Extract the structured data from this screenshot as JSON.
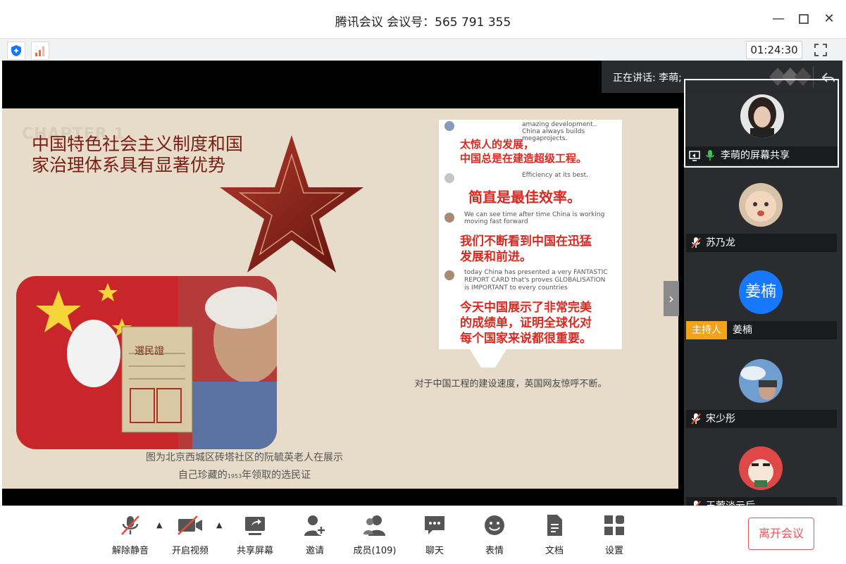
{
  "window": {
    "title": "腾讯会议 会议号：565 791 355"
  },
  "toolstrip": {
    "timer": "01:24:30"
  },
  "speaking": {
    "label": "正在讲话: 李萌;"
  },
  "slide": {
    "chapter": "CHAPTER 1",
    "heading_line1": "中国特色社会主义制度和国",
    "heading_line2": "家治理体系具有显著优势",
    "photo_caption_line1": "图为北京西城区砖塔社区的阮毓英老人在展示",
    "photo_caption_line2_a": "自己珍藏的",
    "photo_caption_line2_year": "1953",
    "photo_caption_line2_b": "年领取的选民证",
    "voter_card_title": "選民證",
    "comments": [
      {
        "en": "amazing development.. China always builds megaprojects.",
        "zh1": "太惊人的发展，",
        "zh2": "中国总是在建造超级工程。"
      },
      {
        "en": "Efficiency at its best.",
        "zh1": "简直是最佳效率。",
        "zh2": ""
      },
      {
        "en": "We can see time after time China is working moving fast forward",
        "zh1": "我们不断看到中国在迅猛",
        "zh2": "发展和前进。"
      },
      {
        "en": "today China has presented a very FANTASTIC REPORT CARD that's proves GLOBALISATION is IMPORTANT to every countries",
        "zh1": "今天中国展示了非常完美",
        "zh2": "的成绩单，证明全球化对",
        "zh3": "每个国家来说都很重要。"
      }
    ],
    "shot_caption": "对于中国工程的建设速度，英国网友惊呼不断。"
  },
  "participants": [
    {
      "name": "李萌的屏幕共享",
      "mic": "on",
      "avatar_color": "#3a3a3a"
    },
    {
      "name": "苏乃龙",
      "mic": "muted",
      "avatar_color": "#d8c3a8"
    },
    {
      "name": "姜楠",
      "mic": "none",
      "host": "主持人",
      "avatar_text": "姜楠",
      "avatar_color": "#1677ff"
    },
    {
      "name": "宋少彤",
      "mic": "muted",
      "avatar_color": "#7ea9d4"
    },
    {
      "name": "王莺淡云后",
      "mic": "muted",
      "avatar_color": "#e04848"
    }
  ],
  "toolbar": {
    "unmute": "解除静音",
    "video": "开启视频",
    "share": "共享屏幕",
    "invite": "邀请",
    "members": "成员(109)",
    "chat": "聊天",
    "emoji": "表情",
    "docs": "文档",
    "settings": "设置",
    "leave": "离开会议"
  },
  "colors": {
    "accent": "#1677ff",
    "host_badge": "#f3a21b",
    "leave": "#e0585a",
    "muted_red": "#e84c3d",
    "mic_green": "#3ec15a",
    "slide_bg": "#e6dcc9",
    "heading": "#7a1d14"
  }
}
